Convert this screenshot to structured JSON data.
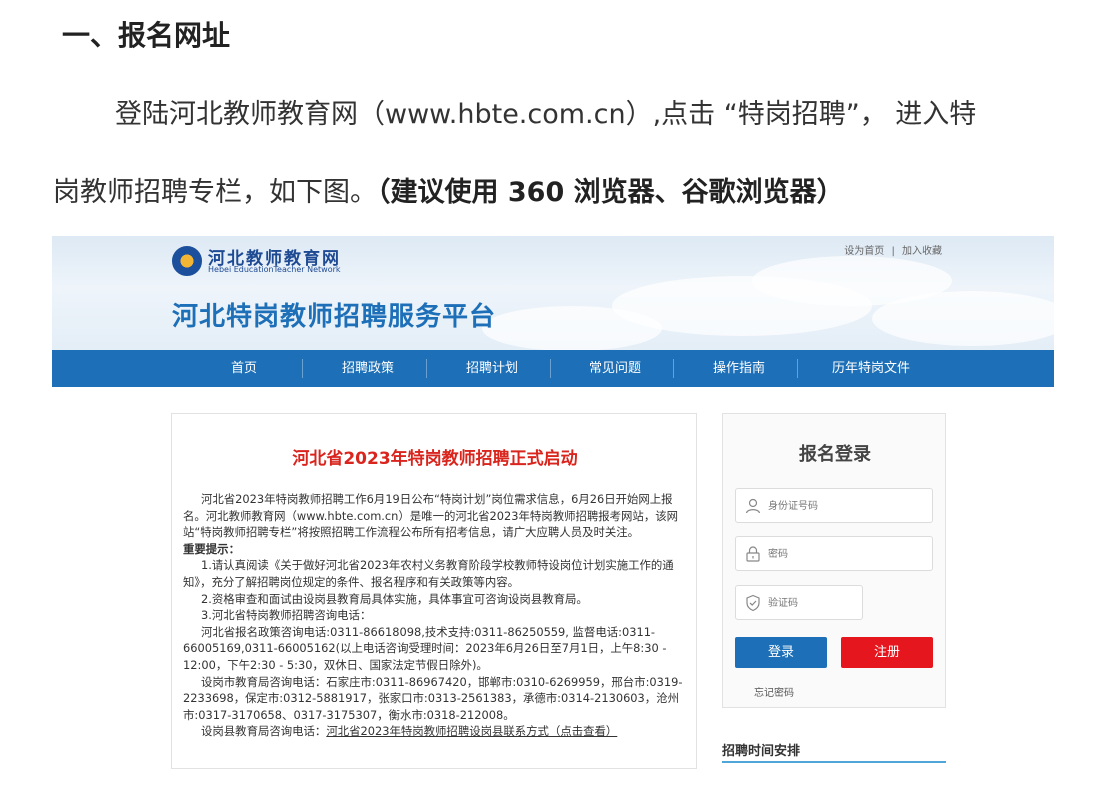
{
  "doc": {
    "heading": "一、报名网址",
    "para1": "登陆河北教师教育网（www.hbte.com.cn）,点击 “特岗招聘”， 进入特",
    "para2_normal": "岗教师招聘专栏，如下图。",
    "para2_bold": "（建议使用 360 浏览器、谷歌浏览器）"
  },
  "site": {
    "logo_cn": "河北教师教育网",
    "logo_en": "Hebei EducationTeacher Network",
    "top_links": [
      "设为首页",
      "加入收藏"
    ],
    "top_sep": "|",
    "platform_title": "河北特岗教师招聘服务平台",
    "nav": [
      "首页",
      "招聘政策",
      "招聘计划",
      "常见问题",
      "操作指南",
      "历年特岗文件"
    ]
  },
  "news": {
    "title": "河北省2023年特岗教师招聘正式启动",
    "intro": "河北省2023年特岗教师招聘工作6月19日公布“特岗计划”岗位需求信息，6月26日开始网上报名。河北教师教育网（www.hbte.com.cn）是唯一的河北省2023年特岗教师招聘报考网站，该网站“特岗教师招聘专栏”将按照招聘工作流程公布所有招考信息，请广大应聘人员及时关注。",
    "important": "重要提示：",
    "item1": "1.请认真阅读《关于做好河北省2023年农村义务教育阶段学校教师特设岗位计划实施工作的通知》，充分了解招聘岗位规定的条件、报名程序和有关政策等内容。",
    "item2": "2.资格审查和面试由设岗县教育局具体实施，具体事宜可咨询设岗县教育局。",
    "item3": "3.河北省特岗教师招聘咨询电话：",
    "item3a": "河北省报名政策咨询电话:0311-86618098,技术支持:0311-86250559, 监督电话:0311-66005169,0311-66005162(以上电话咨询受理时间：2023年6月26日至7月1日，上午8:30 - 12:00，下午2:30 - 5:30，双休日、国家法定节假日除外)。",
    "item3b": "设岗市教育局咨询电话：石家庄市:0311-86967420，邯郸市:0310-6269959，邢台市:0319-2233698，保定市:0312-5881917，张家口市:0313-2561383，承德市:0314-2130603，沧州市:0317-3170658、0317-3175307，衡水市:0318-212008。",
    "item3c_prefix": "设岗县教育局咨询电话：",
    "item3c_link": "河北省2023年特岗教师招聘设岗县联系方式（点击查看）"
  },
  "login": {
    "title": "报名登录",
    "id_placeholder": "身份证号码",
    "pwd_placeholder": "密码",
    "captcha_placeholder": "验证码",
    "login_btn": "登录",
    "register_btn": "注册",
    "forgot": "忘记密码"
  },
  "schedule_title": "招聘时间安排",
  "colors": {
    "brand_blue": "#1d6fb8",
    "title_red": "#d9251d",
    "register_red": "#e5161d"
  }
}
